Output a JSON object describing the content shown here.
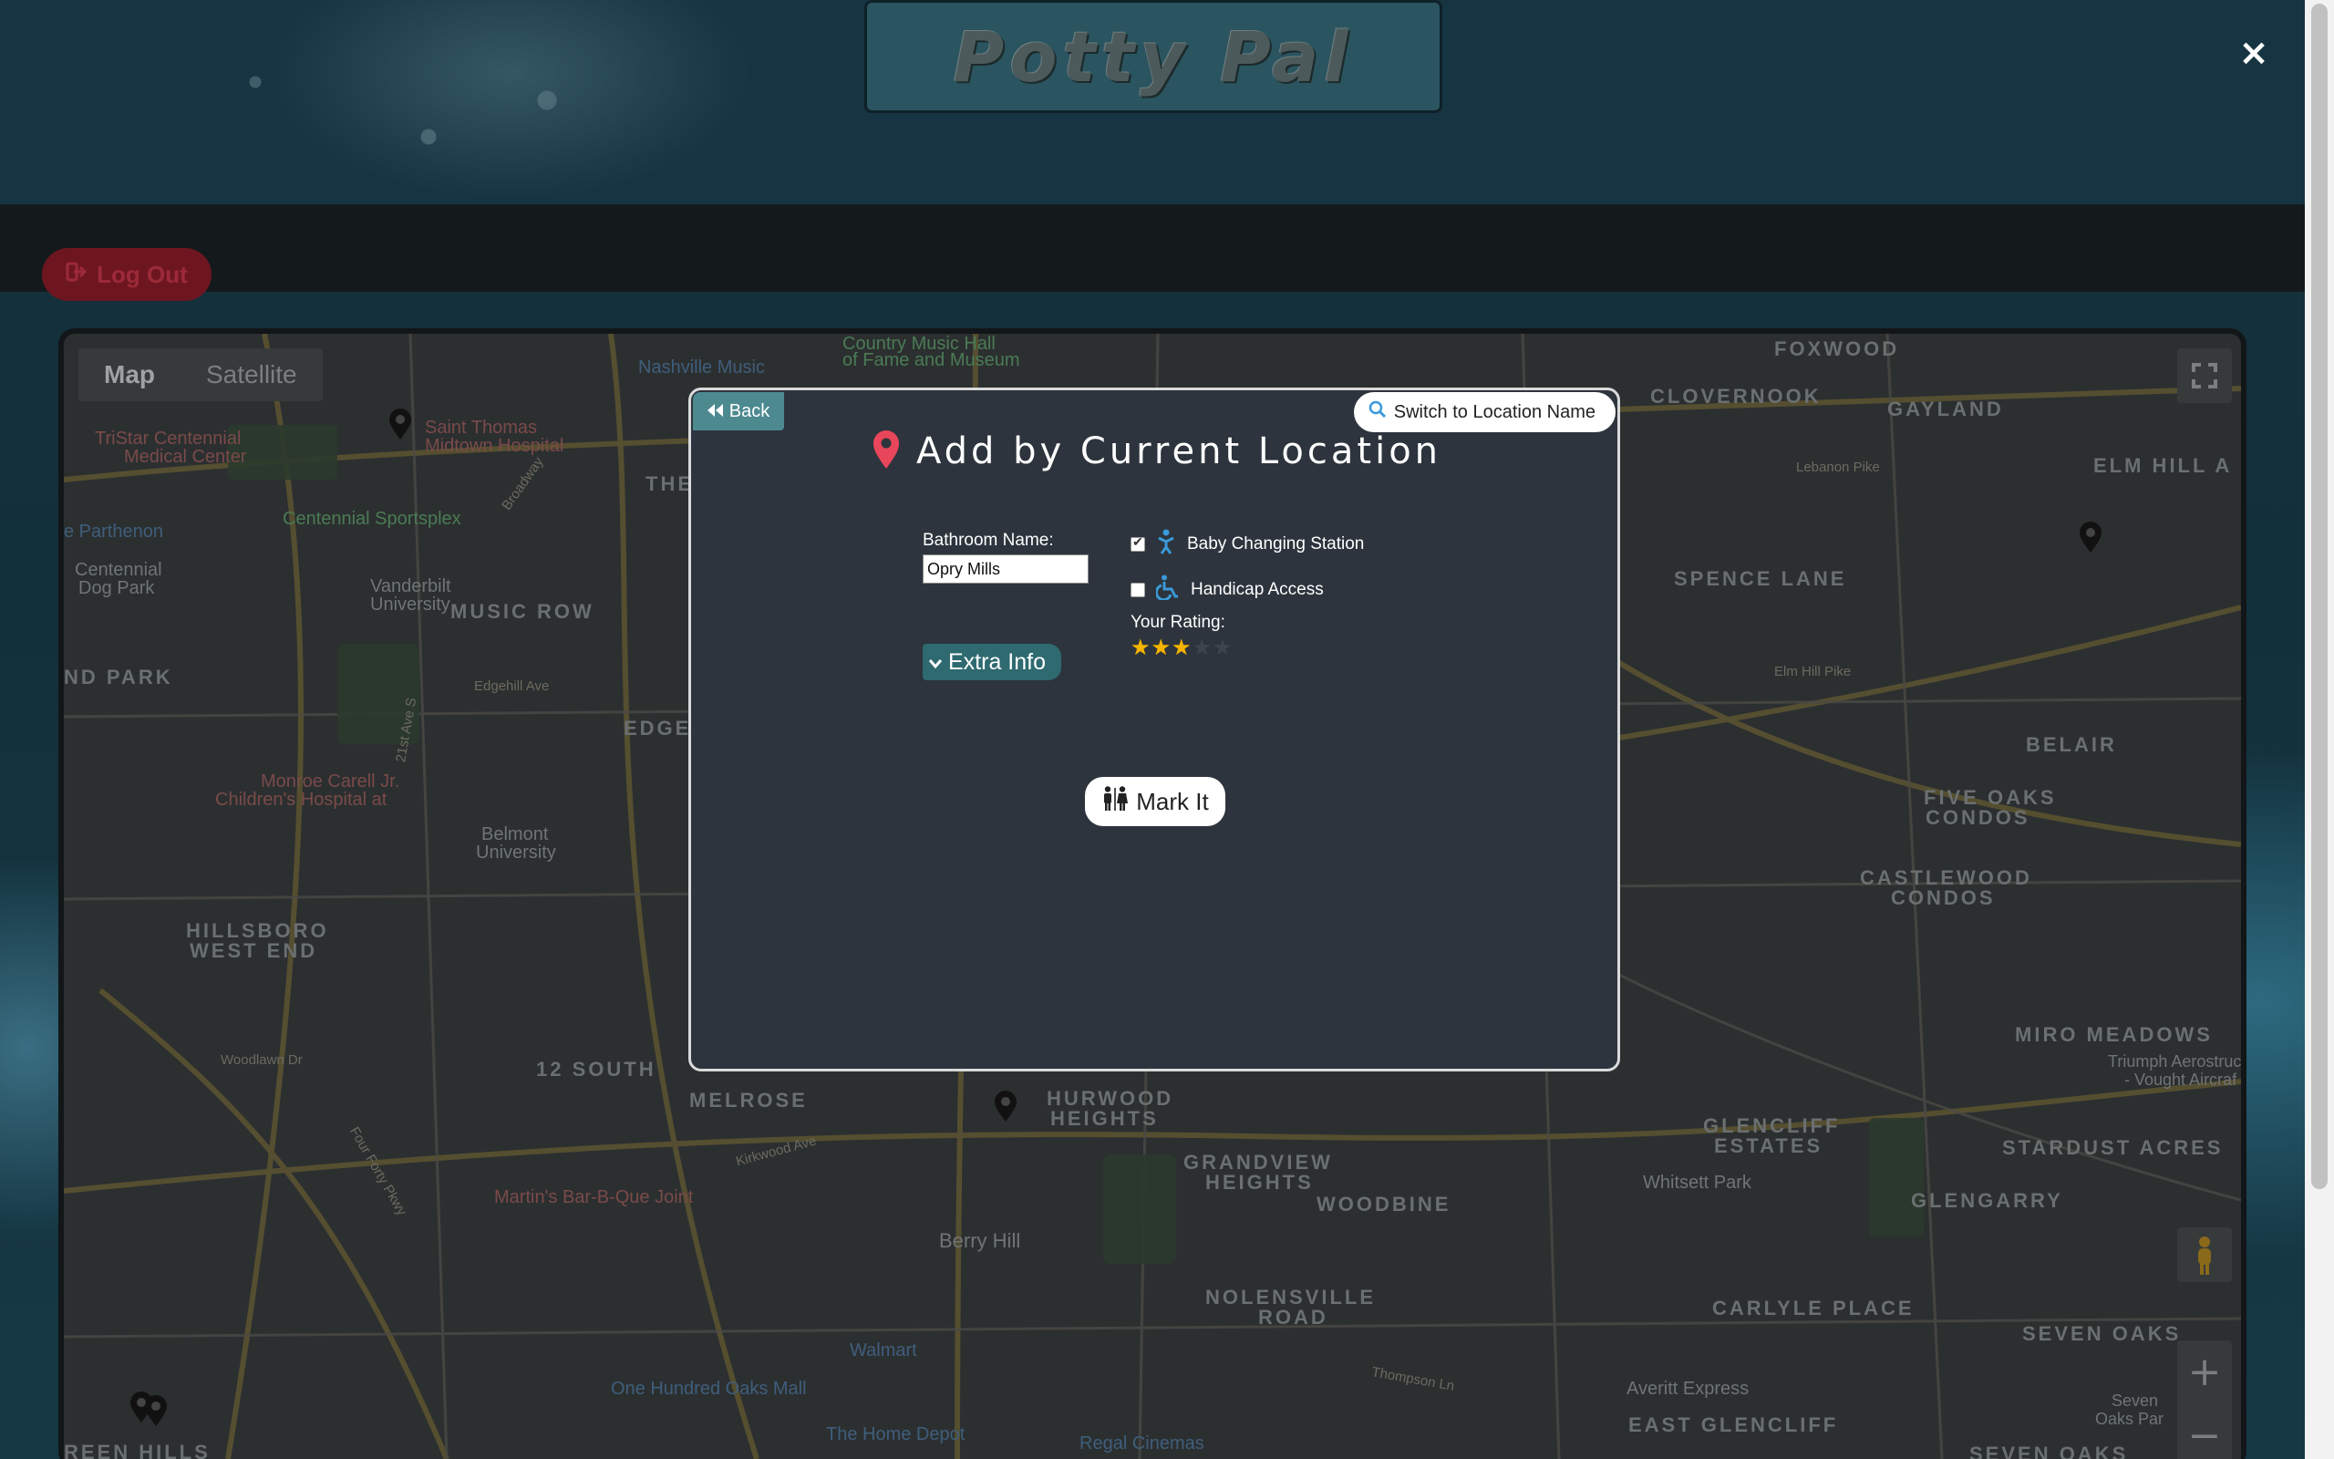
{
  "app": {
    "title": "Potty Pal",
    "close_glyph": "×"
  },
  "nav": {
    "logout_label": "Log Out",
    "logout_icon": "sign-out-icon"
  },
  "map": {
    "type_map_label": "Map",
    "type_satellite_label": "Satellite",
    "active_type": "Map",
    "zoom_in_glyph": "+",
    "zoom_out_glyph": "−",
    "labels": {
      "nashville_music": "Nashville Music",
      "country_music": "Country Music Hall",
      "fame_museum": "of Fame and Museum",
      "foxwood": "FOXWOOD",
      "clovernook": "CLOVERNOOK",
      "gayland": "GAYLAND",
      "elm_hill": "ELM HILL A",
      "tristar": "TriStar Centennial",
      "medical_center": "Medical Center",
      "st_thomas": "Saint Thomas",
      "midtown_hospital": "Midtown Hospital",
      "parthenon": "e Parthenon",
      "centennial_sportsplex": "Centennial Sportsplex",
      "centennial_dog": "Centennial",
      "dog_park": "Dog Park",
      "vanderbilt": "Vanderbilt",
      "university": "University",
      "music_row": "MUSIC ROW",
      "nd_park": "ND PARK",
      "edge": "EDGE",
      "spence_lane": "SPENCE LANE",
      "lebanon_pike": "Lebanon Pike",
      "belair": "BELAIR",
      "five_oaks": "FIVE OAKS",
      "condos": "CONDOS",
      "castlewood": "CASTLEWOOD",
      "castlewood_condos": "CONDOS",
      "monroe_carell": "Monroe Carell Jr.",
      "childrens_hospital": "Children's Hospital at",
      "belmont": "Belmont",
      "belmont_university": "University",
      "hillsboro": "HILLSBORO",
      "west_end": "WEST END",
      "twelve_south": "12 SOUTH",
      "melrose": "MELROSE",
      "hurwood": "HURWOOD",
      "heights": "HEIGHTS",
      "grandview": "GRANDVIEW",
      "grandview_heights": "HEIGHTS",
      "woodbine": "WOODBINE",
      "glencliff": "GLENCLIFF",
      "estates": "ESTATES",
      "whitsett_park": "Whitsett Park",
      "glengarry": "GLENGARRY",
      "miro_meadows": "MIRO MEADOWS",
      "stardust_acres": "STARDUST ACRES",
      "triumph": "Triumph Aerostructu",
      "vought": "- Vought Aircraf",
      "martins": "Martin's Bar-B-Que Joint",
      "berry_hill": "Berry Hill",
      "nolensville": "NOLENSVILLE",
      "road": "ROAD",
      "carlyle_place": "CARLYLE PLACE",
      "seven_oaks": "SEVEN OAKS",
      "walmart": "Walmart",
      "one_hundred_oaks": "One Hundred Oaks Mall",
      "home_depot": "The Home Depot",
      "regal_cinemas": "Regal Cinemas",
      "averitt": "Averitt Express",
      "east_glencliff": "EAST GLENCLIFF",
      "seven_oaks_park": "Seven",
      "oaks_park": "Oaks Par",
      "green_hills": "REEN HILLS",
      "seven_oaks_2": "SEVEN OAKS",
      "elm_hill_pike": "Elm Hill Pike",
      "woodlawn": "Woodlawn Dr",
      "four_forty": "Four Forty Pkwy",
      "kirkwood": "Kirkwood Ave",
      "thompson": "Thompson Ln",
      "edgehill": "Edgehill Ave",
      "broadway": "Broadway",
      "twentyfirst": "21st Ave S",
      "the": "THE"
    }
  },
  "modal": {
    "back_label": "Back",
    "switch_label": "Switch to Location Name",
    "title": "Add by Current Location",
    "name_label": "Bathroom Name:",
    "name_value": "Opry Mills",
    "extra_info_label": "Extra Info",
    "baby_label": "Baby Changing Station",
    "baby_checked": true,
    "handicap_label": "Handicap Access",
    "handicap_checked": false,
    "rating_label": "Your Rating:",
    "rating_value": 3,
    "rating_max": 5,
    "mark_label": "Mark It",
    "pin_color": "#e8465a",
    "accent_icon_color": "#3a9ad9"
  }
}
